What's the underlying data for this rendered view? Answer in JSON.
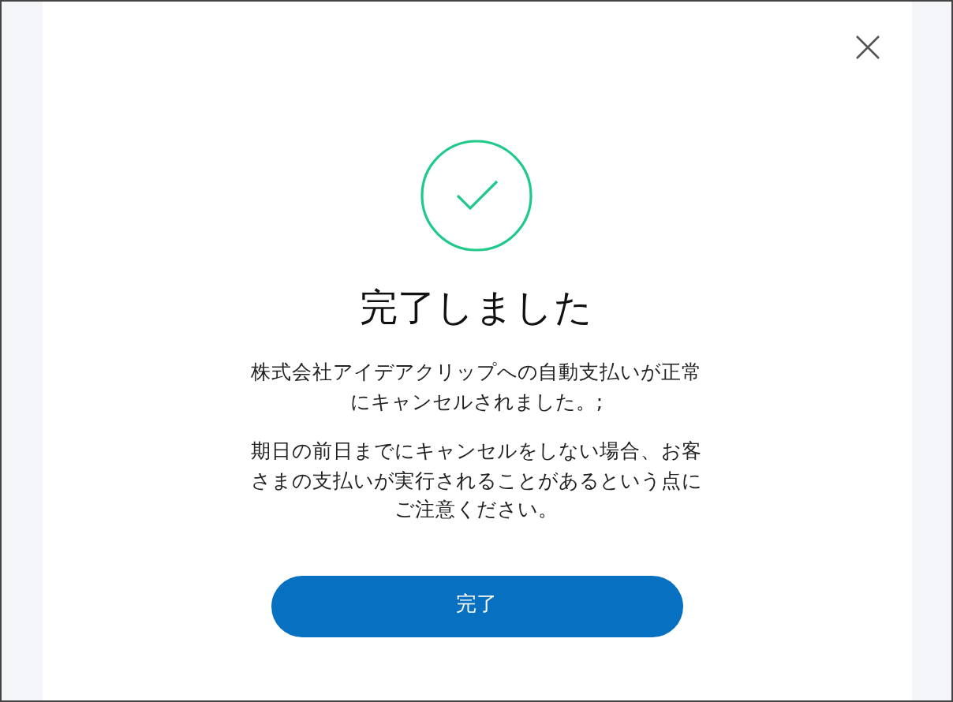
{
  "dialog": {
    "title": "完了しました",
    "paragraphs": [
      [
        "株式会社アイデアクリップへの自動支払いが正常",
        "にキャンセルされました。;"
      ],
      [
        "期日の前日までにキャンセルをしない場合、お客",
        "さまの支払いが実行されることがあるという点に",
        "ご注意ください。"
      ]
    ],
    "button": "完了"
  }
}
